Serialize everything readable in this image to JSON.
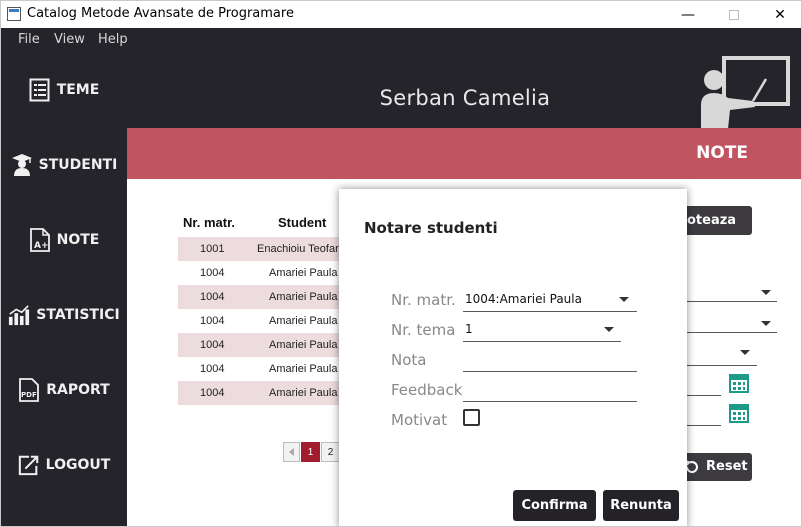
{
  "window": {
    "title": "Catalog Metode Avansate de Programare"
  },
  "menu": [
    "File",
    "View",
    "Help"
  ],
  "sidebar": {
    "items": [
      {
        "label": "TEME",
        "icon": "list-icon"
      },
      {
        "label": "STUDENTI",
        "icon": "graduate-icon"
      },
      {
        "label": "NOTE",
        "icon": "grade-document-icon"
      },
      {
        "label": "STATISTICI",
        "icon": "bar-chart-icon"
      },
      {
        "label": "RAPORT",
        "icon": "pdf-icon"
      },
      {
        "label": "LOGOUT",
        "icon": "logout-icon"
      }
    ]
  },
  "header": {
    "user_name": "Serban Camelia",
    "section": "NOTE"
  },
  "table": {
    "columns": [
      "Nr. matr.",
      "Student"
    ],
    "rows": [
      {
        "id": "1001",
        "name": "Enachioiu Teofan"
      },
      {
        "id": "1004",
        "name": "Amariei Paula"
      },
      {
        "id": "1004",
        "name": "Amariei Paula"
      },
      {
        "id": "1004",
        "name": "Amariei Paula"
      },
      {
        "id": "1004",
        "name": "Amariei Paula"
      },
      {
        "id": "1004",
        "name": "Amariei Paula"
      },
      {
        "id": "1004",
        "name": "Amariei Paula"
      }
    ]
  },
  "pagination": {
    "pages": [
      "1",
      "2"
    ],
    "current": "1"
  },
  "background": {
    "partial_button": "oteaza",
    "reset_label": "Reset"
  },
  "dialog": {
    "title": "Notare studenti",
    "fields": {
      "nr_matr": {
        "label": "Nr. matr.",
        "value": "1004:Amariei Paula"
      },
      "nr_tema": {
        "label": "Nr. tema",
        "value": "1"
      },
      "nota": {
        "label": "Nota",
        "value": ""
      },
      "feedback": {
        "label": "Feedback",
        "value": ""
      },
      "motivat": {
        "label": "Motivat",
        "checked": false
      }
    },
    "confirm_label": "Confirma",
    "cancel_label": "Renunta"
  },
  "colors": {
    "dark": "#25242a",
    "accent": "#c15461",
    "row_alt": "#ecdcdd",
    "page_active": "#a11c2d",
    "calendar": "#1e9a8a"
  }
}
